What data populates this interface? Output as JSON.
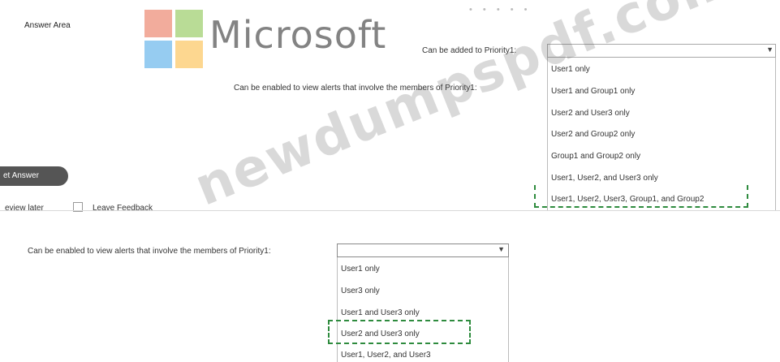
{
  "answer_area_label": "Answer Area",
  "brand": {
    "name": "Microsoft"
  },
  "watermark": "newdumpspdf.com",
  "question1": {
    "prompt": "Can be added to Priority1:",
    "selected": ""
  },
  "question2": {
    "prompt": "Can be enabled to view alerts that involve the members of Priority1:",
    "options": [
      "User1 only",
      "User1 and Group1 only",
      "User2 and User3 only",
      "User2 and Group2 only",
      "Group1 and Group2 only",
      "User1, User2, and User3 only",
      "User1, User2, User3, Group1, and Group2"
    ],
    "highlighted_option": "User1, User2, User3, Group1, and Group2"
  },
  "controls": {
    "reset_answer": "et Answer",
    "review_later": "eview later",
    "leave_feedback": "Leave Feedback"
  },
  "question3": {
    "prompt": "Can be enabled to view alerts that involve the members of Priority1:",
    "options": [
      "User1 only",
      "User3 only",
      "User1 and User3 only",
      "User2 and User3 only",
      "User1, User2, and User3"
    ],
    "highlighted_option": "User2 and User3 only"
  },
  "colors": {
    "highlight_dash": "#2e8b3e",
    "reset_button": "#555555"
  }
}
